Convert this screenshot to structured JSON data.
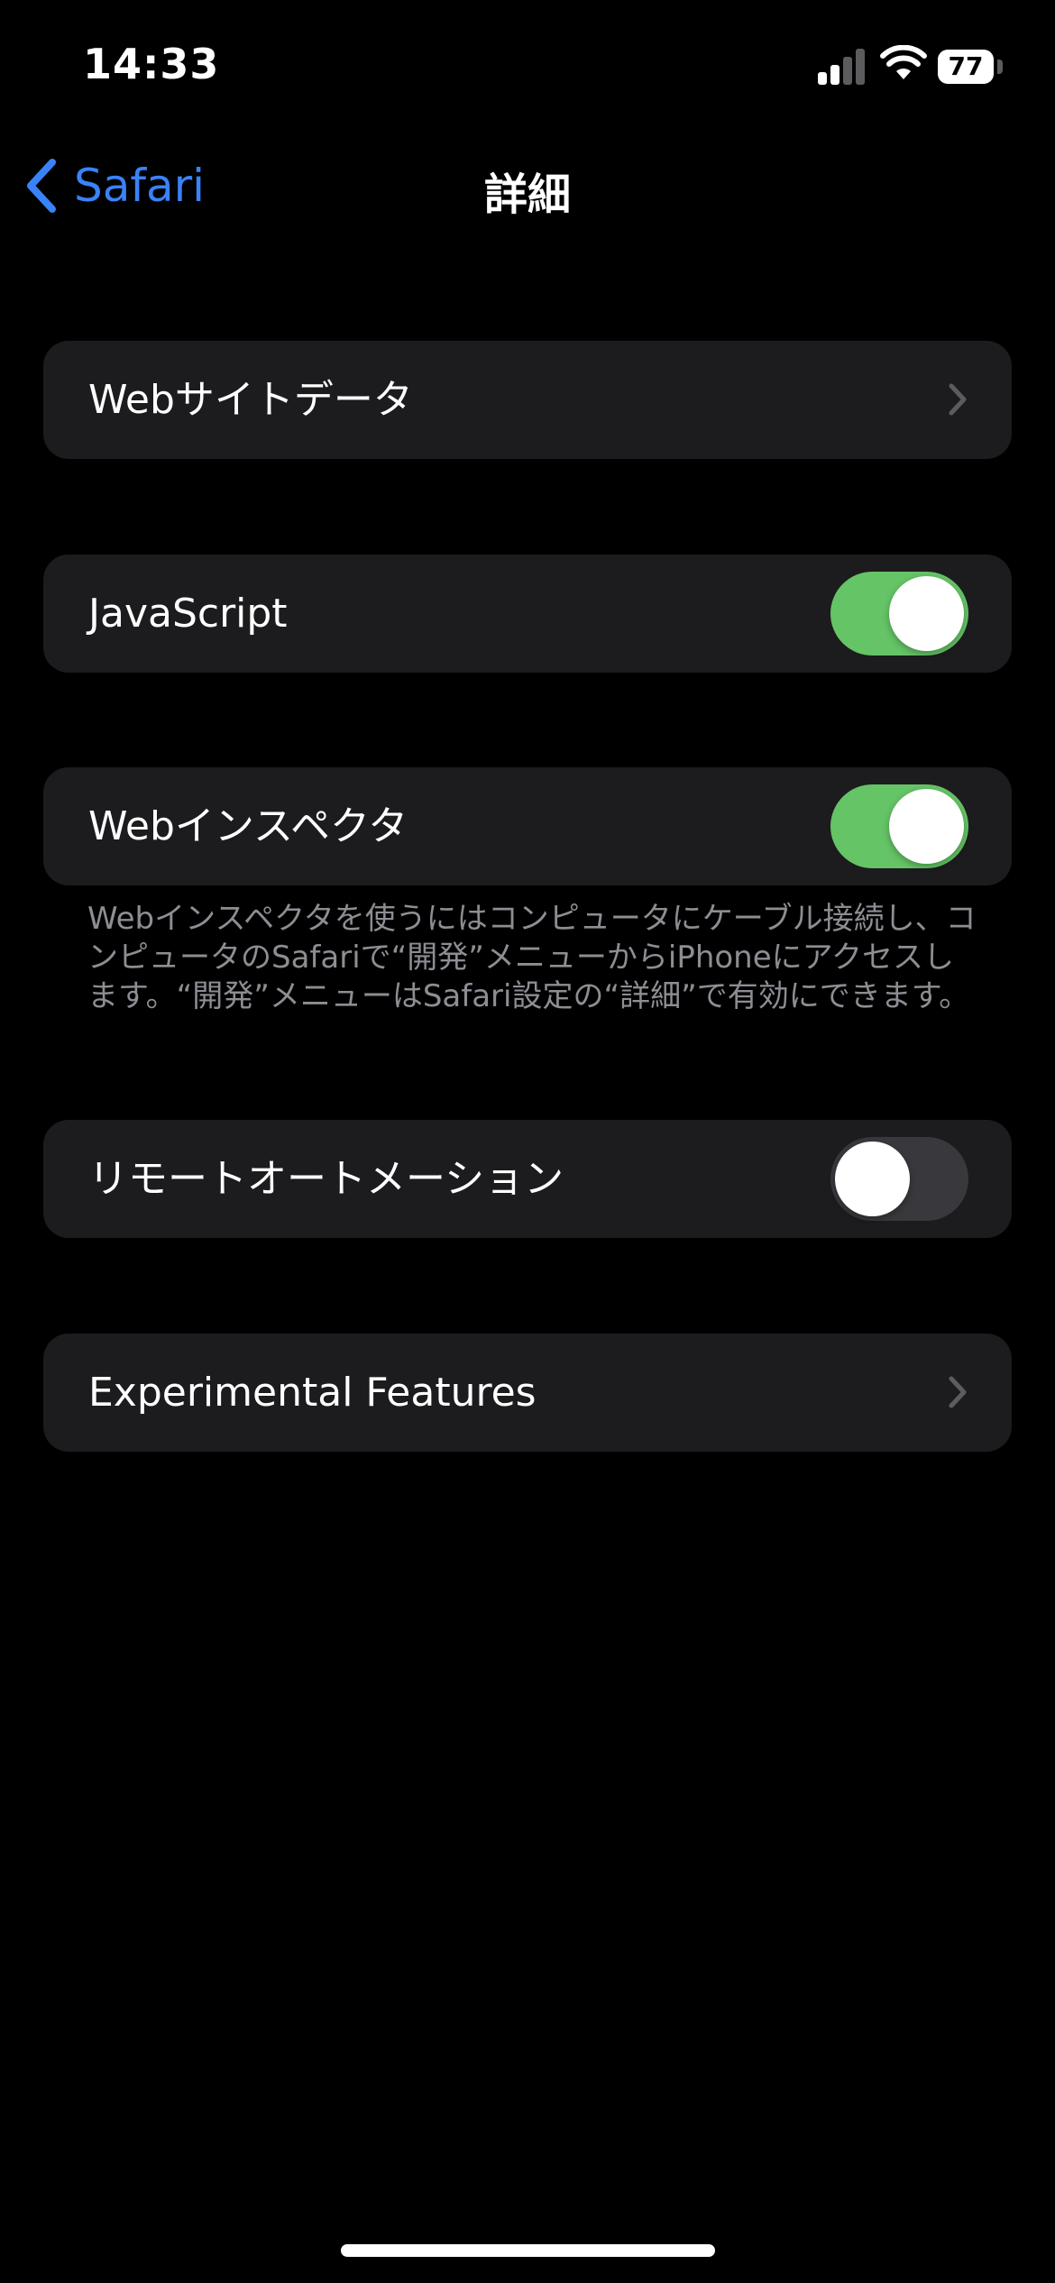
{
  "status_bar": {
    "time": "14:33",
    "battery": "77",
    "signal_icon": "cellular-signal-icon",
    "wifi_icon": "wifi-icon",
    "battery_icon": "battery-icon"
  },
  "nav": {
    "back_label": "Safari",
    "title": "詳細",
    "back_icon": "chevron-left-icon",
    "accent_color": "#3a82f7"
  },
  "rows": {
    "website_data": {
      "label": "Webサイトデータ",
      "icon": "chevron-right-icon"
    },
    "javascript": {
      "label": "JavaScript",
      "enabled": true
    },
    "web_inspector": {
      "label": "Webインスペクタ",
      "enabled": true
    },
    "web_inspector_footer": "Webインスペクタを使うにはコンピュータにケーブル接続し、コンピュータのSafariで“開発”メニューからiPhoneにアクセスします。“開発”メニューはSafari設定の“詳細”で有効にできます。",
    "remote_automation": {
      "label": "リモートオートメーション",
      "enabled": false
    },
    "experimental_features": {
      "label": "Experimental Features",
      "icon": "chevron-right-icon"
    }
  },
  "colors": {
    "toggle_on": "#65c466",
    "toggle_off": "#39393d",
    "cell_background": "#1c1c1e",
    "footnote_text": "#8d8d93"
  }
}
